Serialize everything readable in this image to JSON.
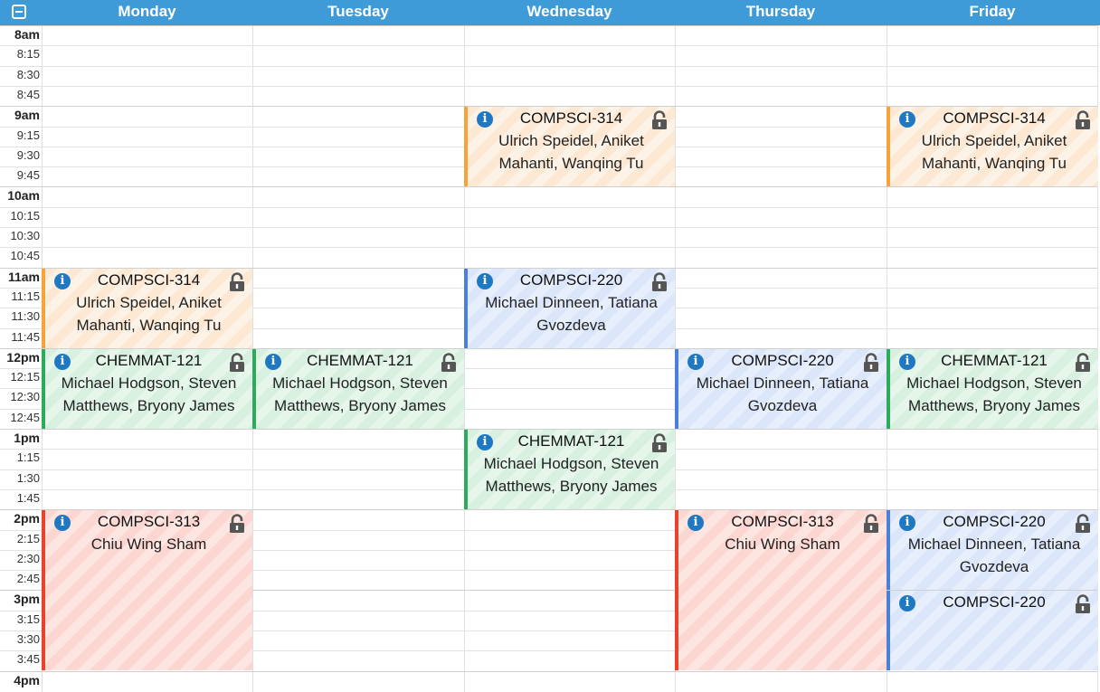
{
  "header": {
    "days": [
      "Monday",
      "Tuesday",
      "Wednesday",
      "Thursday",
      "Friday"
    ]
  },
  "times": [
    "8am",
    "8:15",
    "8:30",
    "8:45",
    "9am",
    "9:15",
    "9:30",
    "9:45",
    "10am",
    "10:15",
    "10:30",
    "10:45",
    "11am",
    "11:15",
    "11:30",
    "11:45",
    "12pm",
    "12:15",
    "12:30",
    "12:45",
    "1pm",
    "1:15",
    "1:30",
    "1:45",
    "2pm",
    "2:15",
    "2:30",
    "2:45",
    "3pm",
    "3:15",
    "3:30",
    "3:45",
    "4pm"
  ],
  "events": [
    {
      "day": 2,
      "start": 4,
      "span": 4,
      "color": "orange",
      "code": "COMPSCI-314",
      "staff": "Ulrich Speidel, Aniket Mahanti, Wanqing Tu"
    },
    {
      "day": 4,
      "start": 4,
      "span": 4,
      "color": "orange",
      "code": "COMPSCI-314",
      "staff": "Ulrich Speidel, Aniket Mahanti, Wanqing Tu"
    },
    {
      "day": 0,
      "start": 12,
      "span": 4,
      "color": "orange",
      "code": "COMPSCI-314",
      "staff": "Ulrich Speidel, Aniket Mahanti, Wanqing Tu"
    },
    {
      "day": 2,
      "start": 12,
      "span": 4,
      "color": "blue",
      "code": "COMPSCI-220",
      "staff": "Michael Dinneen, Tatiana Gvozdeva"
    },
    {
      "day": 0,
      "start": 16,
      "span": 4,
      "color": "green",
      "code": "CHEMMAT-121",
      "staff": "Michael Hodgson, Steven Matthews, Bryony James"
    },
    {
      "day": 1,
      "start": 16,
      "span": 4,
      "color": "green",
      "code": "CHEMMAT-121",
      "staff": "Michael Hodgson, Steven Matthews, Bryony James"
    },
    {
      "day": 3,
      "start": 16,
      "span": 4,
      "color": "blue",
      "code": "COMPSCI-220",
      "staff": "Michael Dinneen, Tatiana Gvozdeva"
    },
    {
      "day": 4,
      "start": 16,
      "span": 4,
      "color": "green",
      "code": "CHEMMAT-121",
      "staff": "Michael Hodgson, Steven Matthews, Bryony James"
    },
    {
      "day": 2,
      "start": 20,
      "span": 4,
      "color": "green",
      "code": "CHEMMAT-121",
      "staff": "Michael Hodgson, Steven Matthews, Bryony James"
    },
    {
      "day": 0,
      "start": 24,
      "span": 8,
      "color": "red",
      "code": "COMPSCI-313",
      "staff": "Chiu Wing Sham"
    },
    {
      "day": 3,
      "start": 24,
      "span": 8,
      "color": "red",
      "code": "COMPSCI-313",
      "staff": "Chiu Wing Sham"
    },
    {
      "day": 4,
      "start": 24,
      "span": 4,
      "color": "blue",
      "code": "COMPSCI-220",
      "staff": "Michael Dinneen, Tatiana Gvozdeva"
    },
    {
      "day": 4,
      "start": 28,
      "span": 4,
      "color": "blue",
      "code": "COMPSCI-220",
      "staff": ""
    }
  ]
}
